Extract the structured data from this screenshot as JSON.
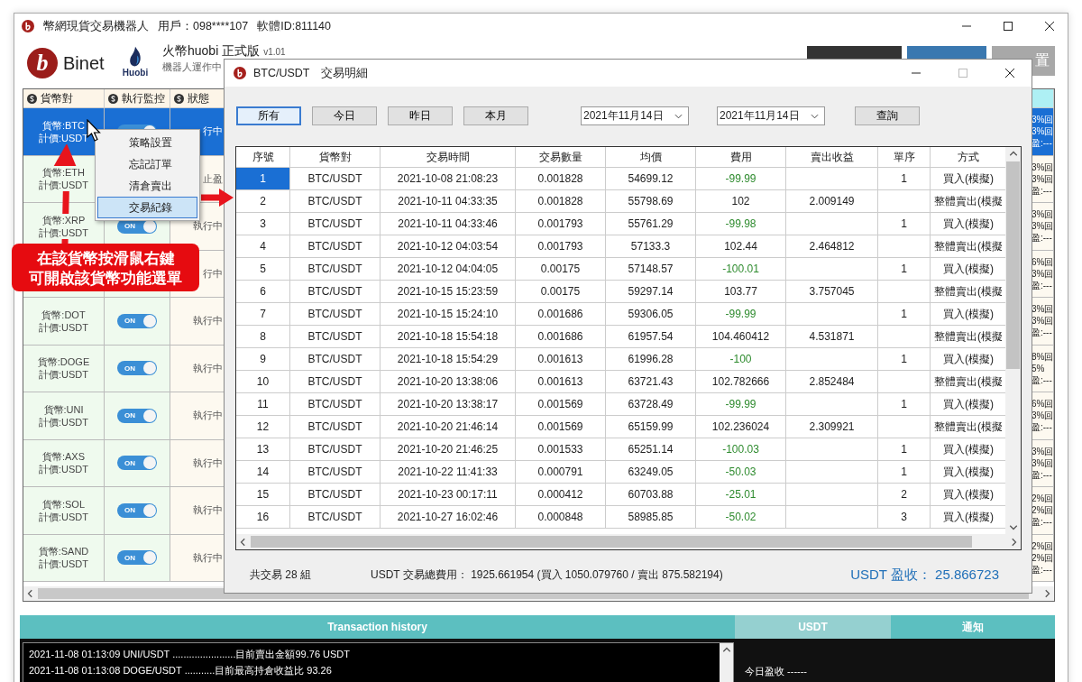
{
  "window": {
    "title": "幣網現貨交易機器人",
    "user": "用戶：098****107",
    "software_id": "軟體ID:811140"
  },
  "header": {
    "binet_logo": {
      "mark": "b",
      "name": "Binet"
    },
    "huobi_logo": {
      "name": "Huobi"
    },
    "product": "火幣huobi 正式版",
    "version": "v1.01",
    "status": "機器人運作中",
    "buttons": [
      {
        "kind": "dark"
      },
      {
        "kind": "blue"
      },
      {
        "kind": "grey",
        "label": "置"
      }
    ]
  },
  "grid": {
    "columns": [
      "貨幣對",
      "執行監控",
      "狀態"
    ],
    "rows": [
      {
        "selected": true,
        "pair": [
          "貨幣:BTC",
          "計價:USDT"
        ],
        "monitor": {
          "on": true
        },
        "status": "行中",
        "fragment": [
          "3%回",
          "3%回",
          "盈:---"
        ]
      },
      {
        "selected": false,
        "pair": [
          "貨幣:ETH",
          "計價:USDT"
        ],
        "status": "止盈",
        "fragment": [
          "3%回",
          "3%回",
          "盈:---"
        ]
      },
      {
        "selected": false,
        "pair": [
          "貨幣:XRP",
          "計價:USDT"
        ],
        "monitor": {
          "on": true,
          "label": "ON"
        },
        "status": "執行中",
        "fragment": [
          "3%回",
          "3%回",
          "盈:---"
        ]
      },
      {
        "selected": false,
        "status": "行中",
        "fragment": [
          "6%回",
          "3%回",
          "盈:---"
        ]
      },
      {
        "selected": false,
        "pair": [
          "貨幣:DOT",
          "計價:USDT"
        ],
        "monitor": {
          "on": true,
          "label": "ON"
        },
        "status": "執行中",
        "fragment": [
          "3%回",
          "3%回",
          "盈:---"
        ]
      },
      {
        "selected": false,
        "pair": [
          "貨幣:DOGE",
          "計價:USDT"
        ],
        "monitor": {
          "on": true,
          "label": "ON"
        },
        "status": "執行中",
        "fragment": [
          "8%回",
          "5%",
          "盈:---"
        ]
      },
      {
        "selected": false,
        "pair": [
          "貨幣:UNI",
          "計價:USDT"
        ],
        "monitor": {
          "on": true,
          "label": "ON"
        },
        "status": "執行中",
        "fragment": [
          "6%回",
          "3%回",
          "盈:---"
        ]
      },
      {
        "selected": false,
        "pair": [
          "貨幣:AXS",
          "計價:USDT"
        ],
        "monitor": {
          "on": true,
          "label": "ON"
        },
        "status": "執行中",
        "fragment": [
          "3%回",
          "3%回",
          "盈:---"
        ]
      },
      {
        "selected": false,
        "pair": [
          "貨幣:SOL",
          "計價:USDT"
        ],
        "monitor": {
          "on": true,
          "label": "ON"
        },
        "status": "執行中",
        "fragment": [
          "2%回",
          "2%回",
          "盈:---"
        ]
      },
      {
        "selected": false,
        "pair": [
          "貨幣:SAND",
          "計價:USDT"
        ],
        "monitor": {
          "on": true,
          "label": "ON"
        },
        "status": "執行中",
        "fragment": [
          "2%回",
          "2%回",
          "盈:---"
        ]
      }
    ]
  },
  "context_menu": {
    "items": [
      {
        "label": "策略設置",
        "selected": false
      },
      {
        "label": "忘記訂單",
        "selected": false
      },
      {
        "label": "清倉賣出",
        "selected": false
      },
      {
        "label": "交易紀錄",
        "selected": true
      }
    ]
  },
  "callout": [
    "在該貨幣按滑鼠右鍵",
    "可開啟該貨幣功能選單"
  ],
  "bottom": {
    "sections": [
      {
        "label": "Transaction history",
        "selected": false
      },
      {
        "label": "USDT",
        "selected": true
      },
      {
        "label": "通知",
        "selected": false
      }
    ],
    "log": [
      "2021-11-08 01:13:09 UNI/USDT .......................目前賣出金額99.76 USDT",
      "2021-11-08 01:13:08 DOGE/USDT ...........目前最高持倉收益比 93.26"
    ],
    "profit_today": "今日盈收 ------"
  },
  "dialog": {
    "title": "BTC/USDT　交易明細",
    "filters": [
      {
        "label": "所有",
        "selected": true
      },
      {
        "label": "今日",
        "selected": false
      },
      {
        "label": "昨日",
        "selected": false
      },
      {
        "label": "本月",
        "selected": false
      }
    ],
    "date_from": "2021年11月14日",
    "date_to": "2021年11月14日",
    "query_button": "查詢",
    "table": {
      "columns": [
        "序號",
        "貨幣對",
        "交易時間",
        "交易數量",
        "均價",
        "費用",
        "賣出收益",
        "單序",
        "方式"
      ],
      "rows": [
        {
          "selected": true,
          "kind": "buy",
          "cells": [
            "1",
            "BTC/USDT",
            "2021-10-08 21:08:23",
            "0.001828",
            "54699.12",
            "-99.99",
            "",
            "1",
            "買入(模擬)"
          ]
        },
        {
          "selected": false,
          "kind": "sell",
          "cells": [
            "2",
            "BTC/USDT",
            "2021-10-11 04:33:35",
            "0.001828",
            "55798.69",
            "102",
            "2.009149",
            "",
            "整體賣出(模擬"
          ]
        },
        {
          "selected": false,
          "kind": "buy",
          "cells": [
            "3",
            "BTC/USDT",
            "2021-10-11 04:33:46",
            "0.001793",
            "55761.29",
            "-99.98",
            "",
            "1",
            "買入(模擬)"
          ]
        },
        {
          "selected": false,
          "kind": "sell",
          "cells": [
            "4",
            "BTC/USDT",
            "2021-10-12 04:03:54",
            "0.001793",
            "57133.3",
            "102.44",
            "2.464812",
            "",
            "整體賣出(模擬"
          ]
        },
        {
          "selected": false,
          "kind": "buy",
          "cells": [
            "5",
            "BTC/USDT",
            "2021-10-12 04:04:05",
            "0.00175",
            "57148.57",
            "-100.01",
            "",
            "1",
            "買入(模擬)"
          ]
        },
        {
          "selected": false,
          "kind": "sell",
          "cells": [
            "6",
            "BTC/USDT",
            "2021-10-15 15:23:59",
            "0.00175",
            "59297.14",
            "103.77",
            "3.757045",
            "",
            "整體賣出(模擬"
          ]
        },
        {
          "selected": false,
          "kind": "buy",
          "cells": [
            "7",
            "BTC/USDT",
            "2021-10-15 15:24:10",
            "0.001686",
            "59306.05",
            "-99.99",
            "",
            "1",
            "買入(模擬)"
          ]
        },
        {
          "selected": false,
          "kind": "sell",
          "cells": [
            "8",
            "BTC/USDT",
            "2021-10-18 15:54:18",
            "0.001686",
            "61957.54",
            "104.460412",
            "4.531871",
            "",
            "整體賣出(模擬"
          ]
        },
        {
          "selected": false,
          "kind": "buy",
          "cells": [
            "9",
            "BTC/USDT",
            "2021-10-18 15:54:29",
            "0.001613",
            "61996.28",
            "-100",
            "",
            "1",
            "買入(模擬)"
          ]
        },
        {
          "selected": false,
          "kind": "sell",
          "cells": [
            "10",
            "BTC/USDT",
            "2021-10-20 13:38:06",
            "0.001613",
            "63721.43",
            "102.782666",
            "2.852484",
            "",
            "整體賣出(模擬"
          ]
        },
        {
          "selected": false,
          "kind": "buy",
          "cells": [
            "11",
            "BTC/USDT",
            "2021-10-20 13:38:17",
            "0.001569",
            "63728.49",
            "-99.99",
            "",
            "1",
            "買入(模擬)"
          ]
        },
        {
          "selected": false,
          "kind": "sell",
          "cells": [
            "12",
            "BTC/USDT",
            "2021-10-20 21:46:14",
            "0.001569",
            "65159.99",
            "102.236024",
            "2.309921",
            "",
            "整體賣出(模擬"
          ]
        },
        {
          "selected": false,
          "kind": "buy",
          "cells": [
            "13",
            "BTC/USDT",
            "2021-10-20 21:46:25",
            "0.001533",
            "65251.14",
            "-100.03",
            "",
            "1",
            "買入(模擬)"
          ]
        },
        {
          "selected": false,
          "kind": "buy",
          "cells": [
            "14",
            "BTC/USDT",
            "2021-10-22 11:41:33",
            "0.000791",
            "63249.05",
            "-50.03",
            "",
            "1",
            "買入(模擬)"
          ]
        },
        {
          "selected": false,
          "kind": "buy",
          "cells": [
            "15",
            "BTC/USDT",
            "2021-10-23 00:17:11",
            "0.000412",
            "60703.88",
            "-25.01",
            "",
            "2",
            "買入(模擬)"
          ]
        },
        {
          "selected": false,
          "kind": "buy",
          "cells": [
            "16",
            "BTC/USDT",
            "2021-10-27 16:02:46",
            "0.000848",
            "58985.85",
            "-50.02",
            "",
            "3",
            "買入(模擬)"
          ]
        }
      ]
    },
    "trade_count": "共交易 28 組",
    "fee_summary": "USDT 交易總費用： 1925.661954 (買入 1050.079760 / 賣出 875.582194)",
    "profit": "USDT 盈收： 25.866723"
  }
}
